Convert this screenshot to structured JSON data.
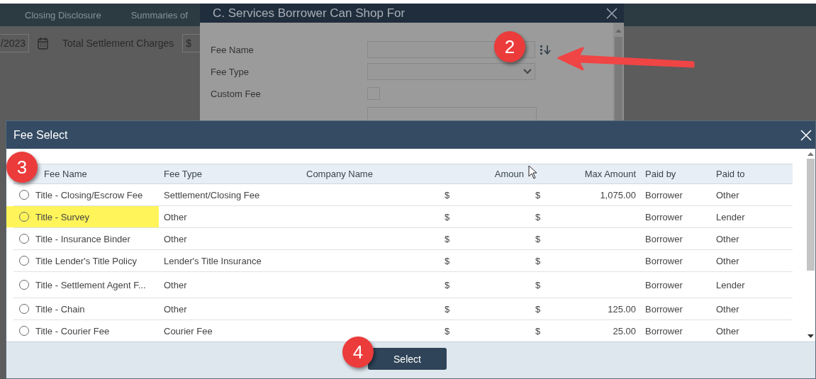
{
  "app": {
    "tabs": [
      {
        "label": "Closing Disclosure"
      },
      {
        "label": "Summaries of"
      }
    ],
    "date_field": {
      "value": "/2023"
    },
    "total_label": "Total Settlement Charges",
    "total_field": {
      "value": "$"
    }
  },
  "services_dialog": {
    "title": "C. Services Borrower Can Shop For",
    "fields": [
      {
        "label": "Fee Name",
        "kind": "text"
      },
      {
        "label": "Fee Type",
        "kind": "select"
      },
      {
        "label": "Custom Fee",
        "kind": "checkbox",
        "checked": false
      }
    ]
  },
  "fee_select": {
    "title": "Fee Select",
    "columns": [
      "Fee Name",
      "Fee Type",
      "Company Name",
      "Amoun",
      "Max Amount",
      "Paid by",
      "Paid to"
    ],
    "rows": [
      {
        "fee_name": "Title - Closing/Escrow Fee",
        "fee_type": "Settlement/Closing Fee",
        "amount": "$",
        "max_symbol": "$",
        "max_amount": "1,075.00",
        "paid_by": "Borrower",
        "paid_to": "Other",
        "selected": false,
        "highlighted": false
      },
      {
        "fee_name": "Title - Survey",
        "fee_type": "Other",
        "amount": "$",
        "max_symbol": "$",
        "max_amount": "",
        "paid_by": "Borrower",
        "paid_to": "Lender",
        "selected": false,
        "highlighted": true
      },
      {
        "fee_name": "Title - Insurance Binder",
        "fee_type": "Other",
        "amount": "$",
        "max_symbol": "$",
        "max_amount": "",
        "paid_by": "Borrower",
        "paid_to": "Other",
        "selected": false,
        "highlighted": false
      },
      {
        "fee_name": "Title Lender's Title Policy",
        "fee_type": "Lender's Title Insurance",
        "amount": "$",
        "max_symbol": "$",
        "max_amount": "",
        "paid_by": "Borrower",
        "paid_to": "Other",
        "selected": false,
        "highlighted": false
      },
      {
        "fee_name": "Title - Settlement Agent F...",
        "fee_type": "Other",
        "amount": "$",
        "max_symbol": "$",
        "max_amount": "",
        "paid_by": "Borrower",
        "paid_to": "Lender",
        "selected": false,
        "highlighted": false
      },
      {
        "fee_name": "Title - Chain",
        "fee_type": "Other",
        "amount": "$",
        "max_symbol": "$",
        "max_amount": "125.00",
        "paid_by": "Borrower",
        "paid_to": "Other",
        "selected": false,
        "highlighted": false
      },
      {
        "fee_name": "Title - Courier Fee",
        "fee_type": "Courier Fee",
        "amount": "$",
        "max_symbol": "$",
        "max_amount": "25.00",
        "paid_by": "Borrower",
        "paid_to": "Other",
        "selected": false,
        "highlighted": false
      }
    ],
    "select_button": "Select"
  },
  "callouts": [
    {
      "label": "2"
    },
    {
      "label": "3"
    },
    {
      "label": "4"
    }
  ]
}
